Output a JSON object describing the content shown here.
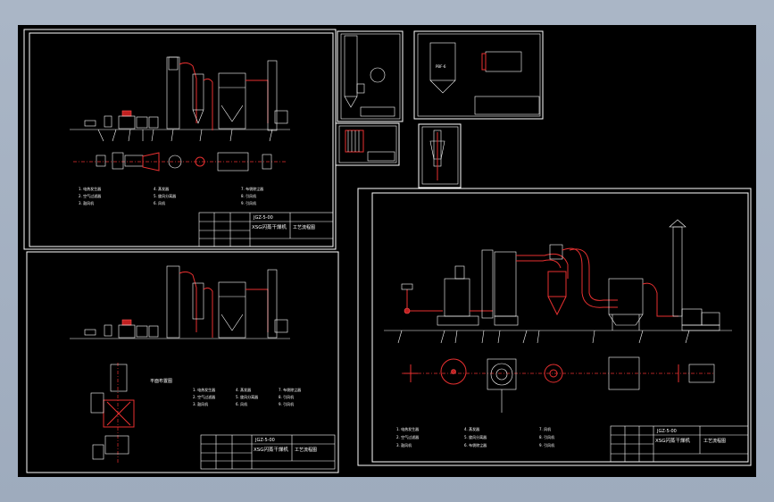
{
  "viewer": {
    "background": "#a8b4c4",
    "canvas_color": "#000000",
    "line_color": "#ffffff",
    "accent": "#e83030"
  },
  "sheet1": {
    "legend": [
      "1. 电热发生器",
      "2. 空气过滤器",
      "3. 鼓风机",
      "4. 蒸发器",
      "5. 旋风分离器",
      "6. 风机",
      "7. 布袋除尘器",
      "8. 引风机",
      "9. 引风机"
    ],
    "title_code": "JGZ-5-00",
    "title_name": "XSG闪蒸干燥机",
    "title_sub": "工艺流程图"
  },
  "sheet2": {
    "side_title": "平面布置图",
    "legend": [
      "1. 电热发生器",
      "2. 空气过滤器",
      "3. 鼓风机",
      "4. 蒸发器",
      "5. 旋风分离器",
      "6. 风机",
      "7. 布袋除尘器",
      "8. 引风机",
      "9. 引风机"
    ],
    "title_code": "JGZ-5-00",
    "title_name": "XSG闪蒸干燥机",
    "title_sub": "工艺流程图"
  },
  "sheet5": {
    "box_label": "PBF-6"
  },
  "sheet6": {
    "legend": [
      "1. 电热发生器",
      "2. 空气过滤器",
      "3. 鼓风机",
      "4. 蒸发器",
      "5. 旋风分离器",
      "6. 布袋除尘器",
      "7. 风机",
      "8. 引风机",
      "9. 引风机"
    ],
    "title_code": "JGZ-5-00",
    "title_name": "XSG闪蒸干燥机",
    "title_sub": "工艺流程图"
  }
}
